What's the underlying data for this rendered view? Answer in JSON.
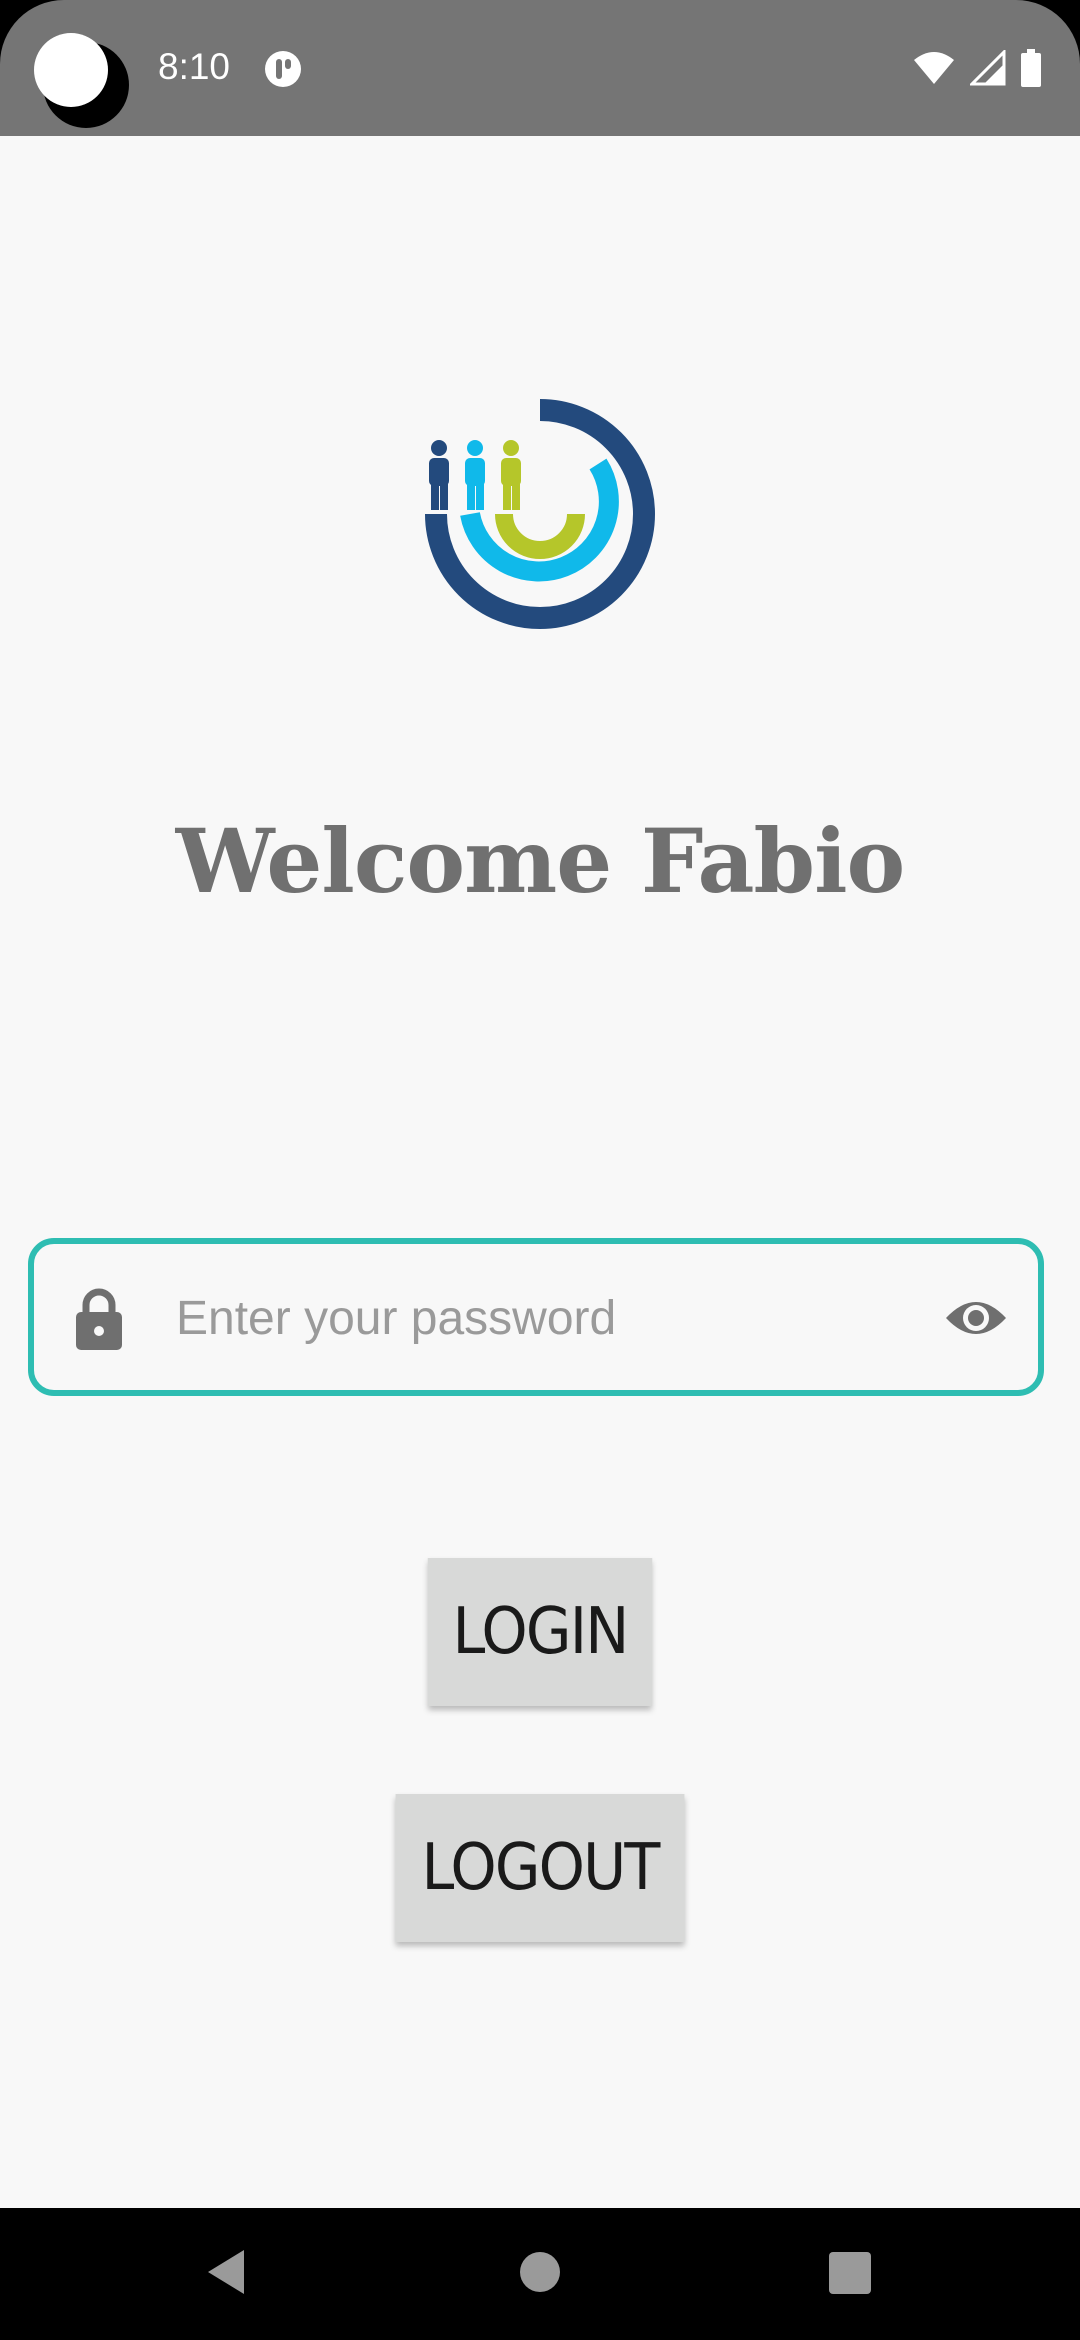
{
  "status_bar": {
    "time": "8:10",
    "icons": [
      "camera-cutout",
      "app-notification-icon",
      "wifi-icon",
      "cellular-signal-icon",
      "battery-icon"
    ]
  },
  "header": {
    "welcome_text": "Welcome Fabio"
  },
  "password_field": {
    "value": "",
    "placeholder": "Enter your password",
    "leading_icon": "lock-icon",
    "trailing_icon": "eye-icon",
    "border_color": "#2ebdb2"
  },
  "buttons": {
    "login_label": "LOGIN",
    "logout_label": "LOGOUT"
  },
  "nav_bar": {
    "icons": [
      "back-icon",
      "home-icon",
      "recents-icon"
    ]
  },
  "colors": {
    "status_bar": "#757575",
    "background": "#f8f8f8",
    "title": "#707070",
    "button": "#d8d9d8",
    "logo_navy": "#234a7d",
    "logo_cyan": "#10b9ea",
    "logo_green": "#b5c62a"
  }
}
